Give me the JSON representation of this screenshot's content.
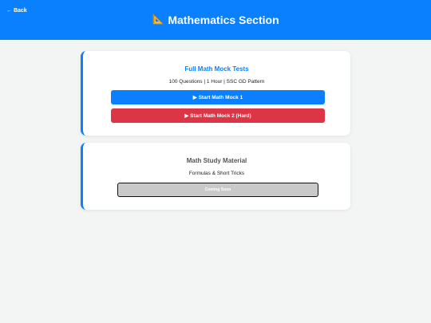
{
  "header": {
    "back_label": "← Back",
    "title_icon": "triangular-ruler-icon",
    "title": "Mathematics Section"
  },
  "cards": [
    {
      "title": "Full Math Mock Tests",
      "subtitle": "100 Questions | 1 Hour | SSC GD Pattern",
      "buttons": [
        {
          "label": "▶ Start Math Mock 1",
          "color": "#0a80ff"
        },
        {
          "label": "▶ Start Math Mock 2 (Hard)",
          "color": "#dc3545"
        }
      ]
    },
    {
      "title": "Math Study Material",
      "subtitle": "Formulas & Short Tricks",
      "buttons": [
        {
          "label": "Coming Soon",
          "color": "#c9c9c9",
          "disabled": true
        }
      ]
    }
  ],
  "colors": {
    "brand": "#0a80ff",
    "danger": "#dc3545",
    "background": "#f3f4f4"
  }
}
